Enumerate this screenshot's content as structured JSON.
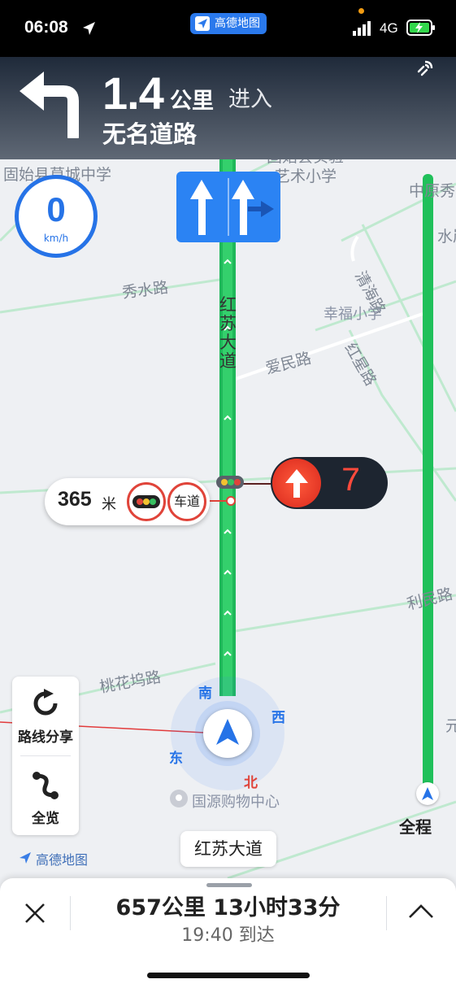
{
  "status_bar": {
    "time": "06:08",
    "app_pill": "高德地图",
    "network": "4G"
  },
  "nav": {
    "distance": "1.4",
    "distance_unit": "公里",
    "action": "进入",
    "road": "无名道路"
  },
  "speed": {
    "value": "0",
    "unit": "km/h"
  },
  "map_labels": {
    "school_1": "固始县莫城中学",
    "school_2_line1": "固始县实验",
    "school_2_line2": "艺术小学",
    "edge_top_right": "中原秀",
    "edge_right": "水岸",
    "xiushui_road": "秀水路",
    "qinghai_road": "清海路",
    "hongsu_avenue": "红苏大道",
    "xingfu_school": "幸福小学",
    "aimin_road": "爱民路",
    "hongxing_road": "红星路",
    "limin_road": "利民路",
    "taohuawu_road": "桃花坞路",
    "edge_yuan": "元",
    "guoyuan_mall": "国源购物中心"
  },
  "traffic_light": {
    "distance": "365",
    "distance_unit": "米",
    "lane_label": "车道",
    "countdown": "7"
  },
  "compass": {
    "south": "南",
    "west": "西",
    "east": "东",
    "north": "北"
  },
  "side_panel": {
    "share_label": "路线分享",
    "overview_label": "全览"
  },
  "full_route_label": "全程",
  "watermark": "高德地图",
  "current_road": "红苏大道",
  "bottom": {
    "summary": "657公里 13小时33分",
    "arrival": "19:40 到达"
  },
  "colors": {
    "route_green": "#20c05a",
    "accent_blue": "#2673e7",
    "alert_red": "#e0443a"
  }
}
